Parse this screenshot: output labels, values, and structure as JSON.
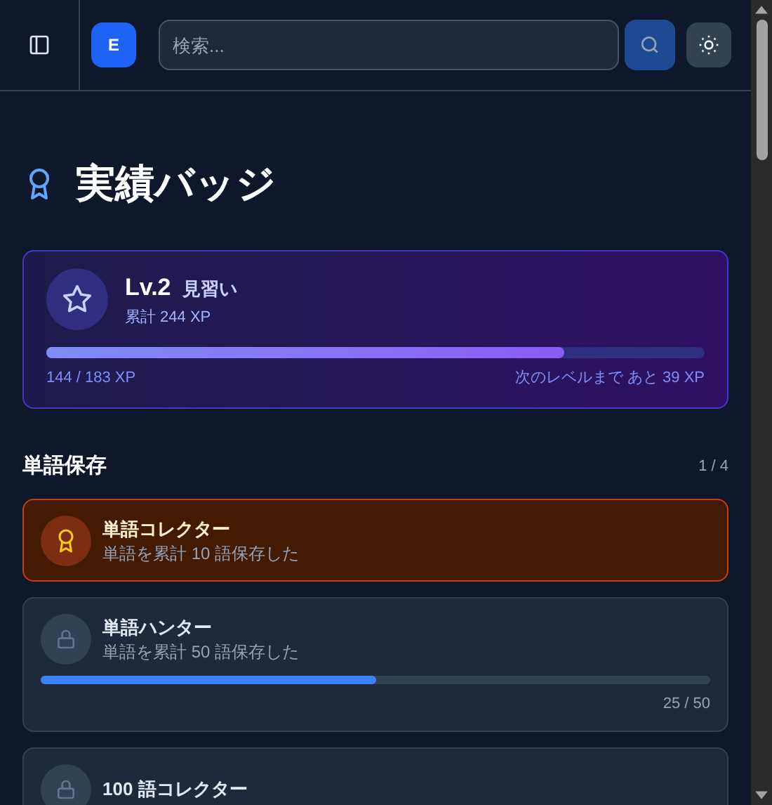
{
  "header": {
    "logo": "E",
    "search": {
      "placeholder": "検索..."
    }
  },
  "title": "実績バッジ",
  "level_card": {
    "level": "Lv.2",
    "rank": "見習い",
    "total": "累計 244 XP",
    "progress": {
      "level": 0.787
    },
    "current": "144 / 183 XP",
    "remaining": "次のレベルまで あと 39 XP"
  },
  "section": {
    "title": "単語保存",
    "count": "1 / 4"
  },
  "badges": [
    {
      "kind": "unlocked",
      "title": "単語コレクター",
      "description": "単語を累計 10 語保存した"
    },
    {
      "kind": "locked",
      "title": "単語ハンター",
      "description": "単語を累計 50 語保存した",
      "level": 0.5,
      "reading": "25 / 50"
    },
    {
      "kind": "locked",
      "title": "100 語コレクター"
    }
  ]
}
